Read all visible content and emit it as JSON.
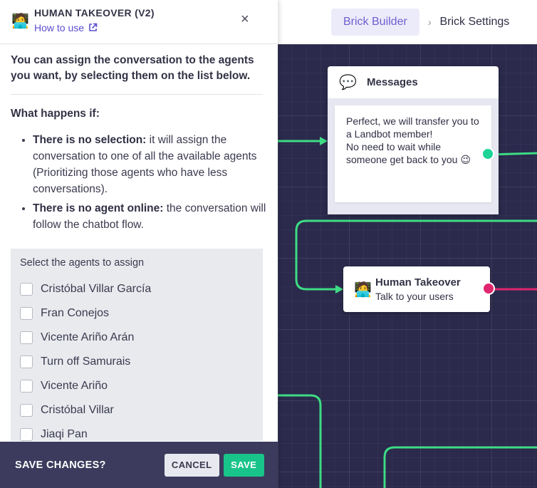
{
  "topbar": {
    "crumb_active": "Brick Builder",
    "separator": "›",
    "crumb_current": "Brick Settings"
  },
  "canvas": {
    "messages_node": {
      "title": "Messages",
      "icon": "speech-bubble-icon",
      "text": "Perfect, we will transfer you to a Landbot member!\nNo need to wait while someone get back to you 😉",
      "output_dot_color": "#1ed397"
    },
    "human_node": {
      "title": "Human Takeover",
      "subtitle": "Talk to your users",
      "icon": "person-at-laptop-icon",
      "output_dot_color": "#e0266e"
    },
    "wire_color": "#3ddc84",
    "wire_color_pink": "#e0266e"
  },
  "panel": {
    "header_icon": "🧑‍💻",
    "title": "HUMAN TAKEOVER (V2)",
    "howto": "How to use",
    "close": "×",
    "intro": "You can assign the conversation to the agents you want, by selecting them on the list below.",
    "what_happens": "What happens if:",
    "cases": [
      {
        "bold": "There is no selection:",
        "text": " it will assign the conversation to one of all the available agents (Prioritizing those agents who have less conversations)."
      },
      {
        "bold": "There is no agent online:",
        "text": " the conversation will follow the chatbot flow."
      }
    ],
    "agents_label": "Select the agents to assign",
    "agents": [
      "Cristóbal Villar García",
      "Fran Conejos",
      "Vicente Ariño Arán",
      "Turn off Samurais",
      "Vicente Ariño",
      "Cristóbal Villar",
      "Jiaqi Pan"
    ]
  },
  "footer": {
    "label": "SAVE CHANGES?",
    "cancel": "CANCEL",
    "save": "SAVE"
  }
}
